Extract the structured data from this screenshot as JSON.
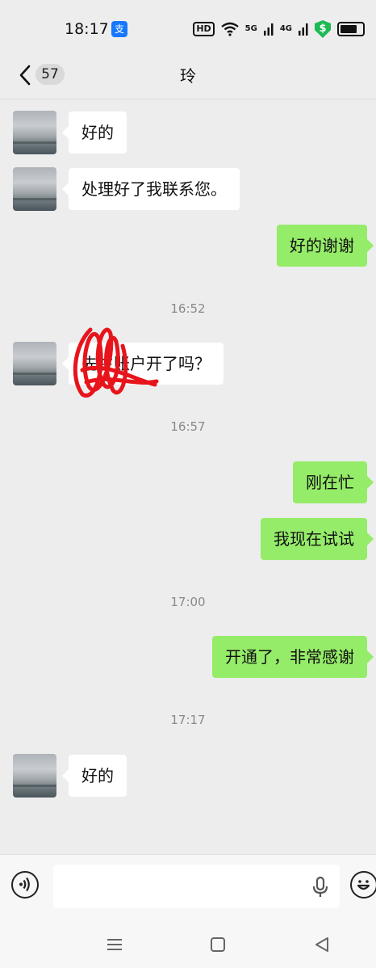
{
  "status_bar": {
    "time": "18:17",
    "app_icon": "支",
    "hd": "HD",
    "net1": "5G",
    "net2": "4G",
    "shield": "$"
  },
  "header": {
    "unread_count": "57",
    "title": "玲"
  },
  "messages": [
    {
      "side": "in",
      "text": "好的"
    },
    {
      "side": "in",
      "text": "处理好了我联系您。"
    },
    {
      "side": "out",
      "text": "好的谢谢"
    },
    {
      "type": "time",
      "text": "16:52"
    },
    {
      "side": "in",
      "text": "先生账户开了吗？"
    },
    {
      "type": "time",
      "text": "16:57"
    },
    {
      "side": "out",
      "text": "刚在忙"
    },
    {
      "side": "out",
      "text": "我现在试试"
    },
    {
      "type": "time",
      "text": "17:00"
    },
    {
      "side": "out",
      "text": "开通了，非常感谢"
    },
    {
      "type": "time",
      "text": "17:17"
    },
    {
      "side": "in",
      "text": "好的"
    }
  ],
  "input": {
    "value": "",
    "placeholder": ""
  },
  "icons": {
    "back": "chevron-left-icon",
    "voice": "voice-icon",
    "mic": "microphone-icon",
    "emoji": "emoji-icon"
  },
  "colors": {
    "background": "#ededed",
    "incoming_bubble": "#ffffff",
    "outgoing_bubble": "#95ec69",
    "scribble": "#e8141c"
  }
}
